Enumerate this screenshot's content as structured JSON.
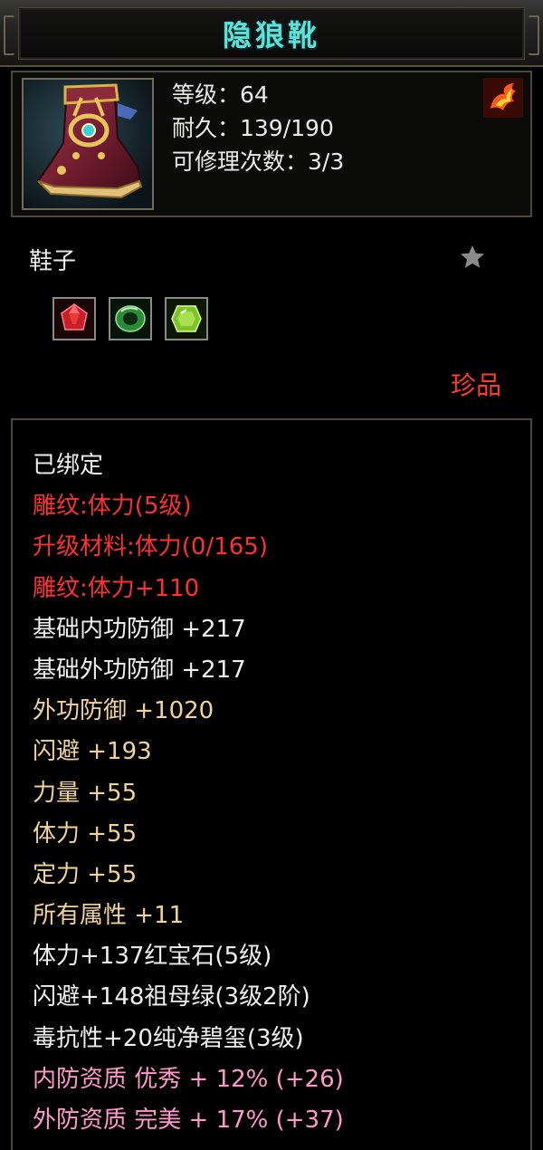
{
  "title": "隐狼靴",
  "item": {
    "icon": "boot-icon",
    "stats": [
      {
        "label": "等级：64"
      },
      {
        "label": "耐久：139/190"
      },
      {
        "label": "可修理次数：3/3"
      }
    ],
    "element_icon": "fire-bird-icon"
  },
  "type_label": "鞋子",
  "favorite_icon": "star-icon",
  "gems": [
    {
      "name": "ruby-gem-icon",
      "color": "#d42a2a"
    },
    {
      "name": "emerald-gem-icon",
      "color": "#3faa3f"
    },
    {
      "name": "jade-gem-icon",
      "color": "#8ed23a"
    }
  ],
  "rarity": "珍品",
  "colors": {
    "white": "#f0f0f0",
    "red": "#ff3030",
    "gold": "#f0d49a",
    "pink": "#ff99cc",
    "title": "#5fe0d8"
  },
  "attributes": [
    {
      "text": "已绑定",
      "color": "white"
    },
    {
      "text": "雕纹:体力(5级)",
      "color": "red"
    },
    {
      "text": "升级材料:体力(0/165)",
      "color": "red"
    },
    {
      "text": "雕纹:体力+110",
      "color": "red"
    },
    {
      "text": "基础内功防御 +217",
      "color": "white"
    },
    {
      "text": "基础外功防御 +217",
      "color": "white"
    },
    {
      "text": "外功防御 +1020",
      "color": "gold"
    },
    {
      "text": "闪避 +193",
      "color": "gold"
    },
    {
      "text": "力量 +55",
      "color": "gold"
    },
    {
      "text": "体力 +55",
      "color": "gold"
    },
    {
      "text": "定力 +55",
      "color": "gold"
    },
    {
      "text": "所有属性 +11",
      "color": "gold"
    },
    {
      "text": "体力+137红宝石(5级)",
      "color": "white"
    },
    {
      "text": "闪避+148祖母绿(3级2阶)",
      "color": "white"
    },
    {
      "text": "毒抗性+20纯净碧玺(3级)",
      "color": "white"
    },
    {
      "text": "内防资质 优秀 + 12% (+26)",
      "color": "pink"
    },
    {
      "text": "外防资质 完美 + 17% (+37)",
      "color": "pink"
    }
  ]
}
